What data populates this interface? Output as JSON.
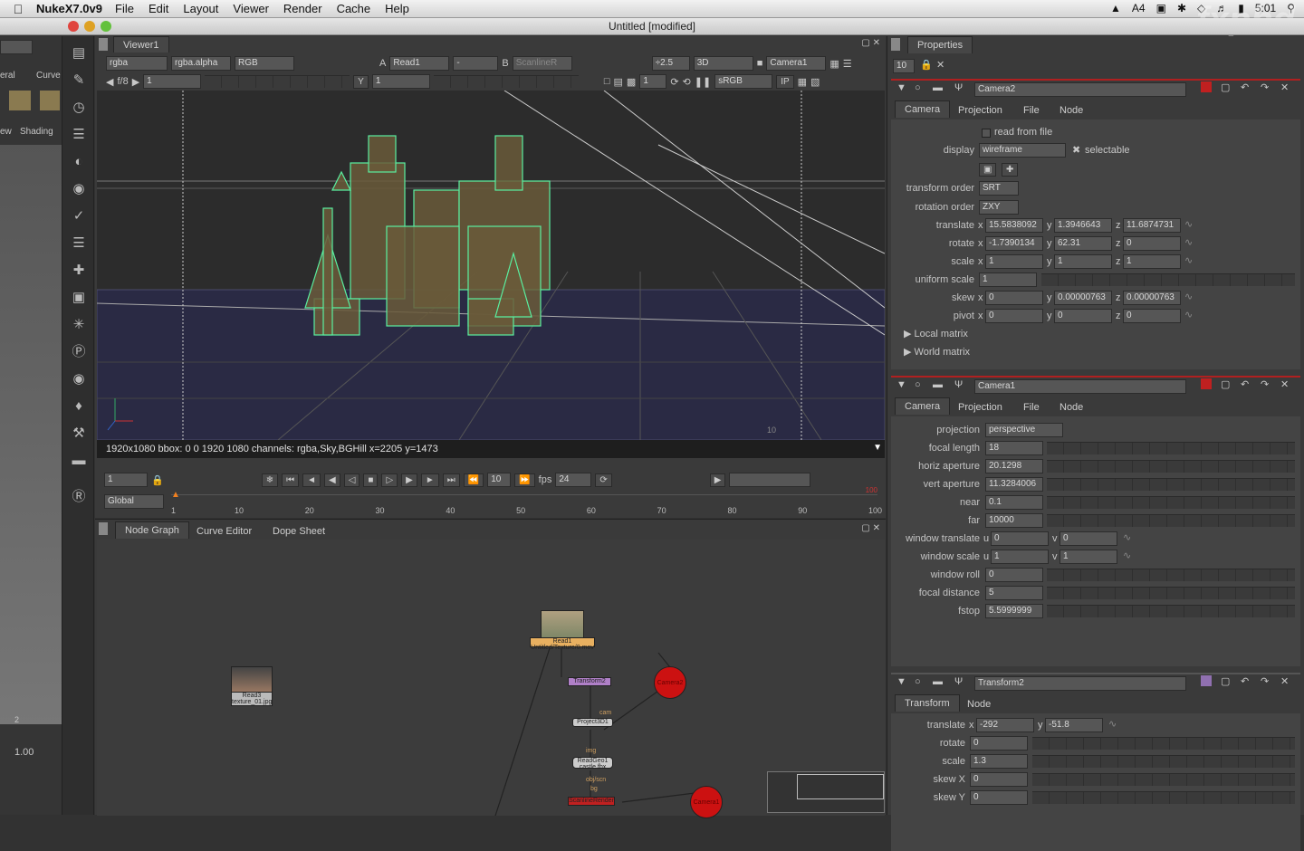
{
  "menubar": {
    "app": "NukeX7.0v9",
    "items": [
      "File",
      "Edit",
      "Layout",
      "Viewer",
      "Render",
      "Cache",
      "Help"
    ],
    "clock": "5:01",
    "badge": "4"
  },
  "window": {
    "title": "Untitled [modified]"
  },
  "watermark": "fxphd",
  "left_panel": {
    "tab_a": "eral",
    "tab_b": "Curve",
    "tab_c": "ew",
    "tab_d": "Shading",
    "value": "1.00",
    "tick": "2"
  },
  "viewer": {
    "tab": "Viewer1",
    "channels": "rgba",
    "alpha": "rgba.alpha",
    "colorspace_in": "RGB",
    "input_a_label": "A",
    "input_a": "Read1",
    "input_a2": "-",
    "input_b_label": "B",
    "input_b": "ScanlineR",
    "gain": "÷2.5",
    "mode": "3D",
    "camera": "Camera1",
    "fstop": "f/8",
    "frame_val": "1",
    "y_label": "Y",
    "y_val": "1",
    "proxy": "1",
    "lut": "sRGB",
    "ip": "IP",
    "status": "1920x1080 bbox: 0 0 1920 1080 channels: rgba,Sky,BGHill  x=2205 y=1473",
    "corner_label": "10"
  },
  "timeline": {
    "frame": "1",
    "inc": "10",
    "fps_label": "fps",
    "fps": "24",
    "range_mode": "Global",
    "ticks": [
      "1",
      "10",
      "20",
      "30",
      "40",
      "50",
      "60",
      "70",
      "80",
      "90",
      "100"
    ],
    "end_marker": "100"
  },
  "nodegraph": {
    "tabs": [
      "Node Graph",
      "Curve Editor",
      "Dope Sheet"
    ],
    "nodes": {
      "read1": "Read1",
      "read_sub": "Untitled/Texture/0.mov",
      "transform": "Transform2",
      "project": "Project3D1",
      "readgeo": "ReadGeo1",
      "readgeo_sub": "castle.fbx",
      "scanline": "ScanlineRender",
      "read3": "Read3",
      "read3_sub": "texture_01.jpg",
      "camera1": "Camera1",
      "camera2": "Camera2",
      "pipe_cam": "cam",
      "pipe_img": "img",
      "pipe_obj": "obj/scn",
      "pipe_bg": "bg"
    }
  },
  "properties": {
    "tab": "Properties",
    "max_panels": "10",
    "camera2": {
      "name": "Camera2",
      "tabs": [
        "Camera",
        "Projection",
        "File",
        "Node"
      ],
      "read_from_file": "read from file",
      "display_label": "display",
      "display": "wireframe",
      "selectable": "selectable",
      "transform_order_label": "transform order",
      "transform_order": "SRT",
      "rotation_order_label": "rotation order",
      "rotation_order": "ZXY",
      "translate_label": "translate",
      "translate": [
        "15.5838092",
        "1.3946643",
        "11.6874731"
      ],
      "rotate_label": "rotate",
      "rotate": [
        "-1.7390134",
        "62.31",
        "0"
      ],
      "scale_label": "scale",
      "scale": [
        "1",
        "1",
        "1"
      ],
      "uniform_scale_label": "uniform scale",
      "uniform_scale": "1",
      "skew_label": "skew",
      "skew": [
        "0",
        "0.00000763",
        "0.00000763"
      ],
      "pivot_label": "pivot",
      "pivot": [
        "0",
        "0",
        "0"
      ],
      "local_matrix": "Local matrix",
      "world_matrix": "World matrix"
    },
    "camera1": {
      "name": "Camera1",
      "tabs": [
        "Camera",
        "Projection",
        "File",
        "Node"
      ],
      "projection_label": "projection",
      "projection": "perspective",
      "focal_length_label": "focal length",
      "focal_length": "18",
      "horiz_aperture_label": "horiz aperture",
      "horiz_aperture": "20.1298",
      "vert_aperture_label": "vert aperture",
      "vert_aperture": "11.3284006",
      "near_label": "near",
      "near": "0.1",
      "far_label": "far",
      "far": "10000",
      "window_translate_label": "window translate",
      "window_translate": [
        "0",
        "0"
      ],
      "window_scale_label": "window scale",
      "window_scale": [
        "1",
        "1"
      ],
      "window_roll_label": "window roll",
      "window_roll": "0",
      "focal_distance_label": "focal distance",
      "focal_distance": "5",
      "fstop_label": "fstop",
      "fstop": "5.5999999"
    },
    "transform2": {
      "name": "Transform2",
      "tabs": [
        "Transform",
        "Node"
      ],
      "translate_label": "translate",
      "translate": [
        "-292",
        "-51.8"
      ],
      "rotate_label": "rotate",
      "rotate": "0",
      "scale_label": "scale",
      "scale": "1.3",
      "skewx_label": "skew X",
      "skewx": "0",
      "skewy_label": "skew Y",
      "skewy": "0"
    },
    "axis_x": "x",
    "axis_y": "y",
    "axis_z": "z",
    "axis_u": "u",
    "axis_v": "v"
  },
  "colors": {
    "wire": "#5af0a0",
    "node_red": "#cc1111",
    "read_orange": "#e8b060",
    "transform_purple": "#b080c8",
    "panel_red": "#b02020"
  }
}
